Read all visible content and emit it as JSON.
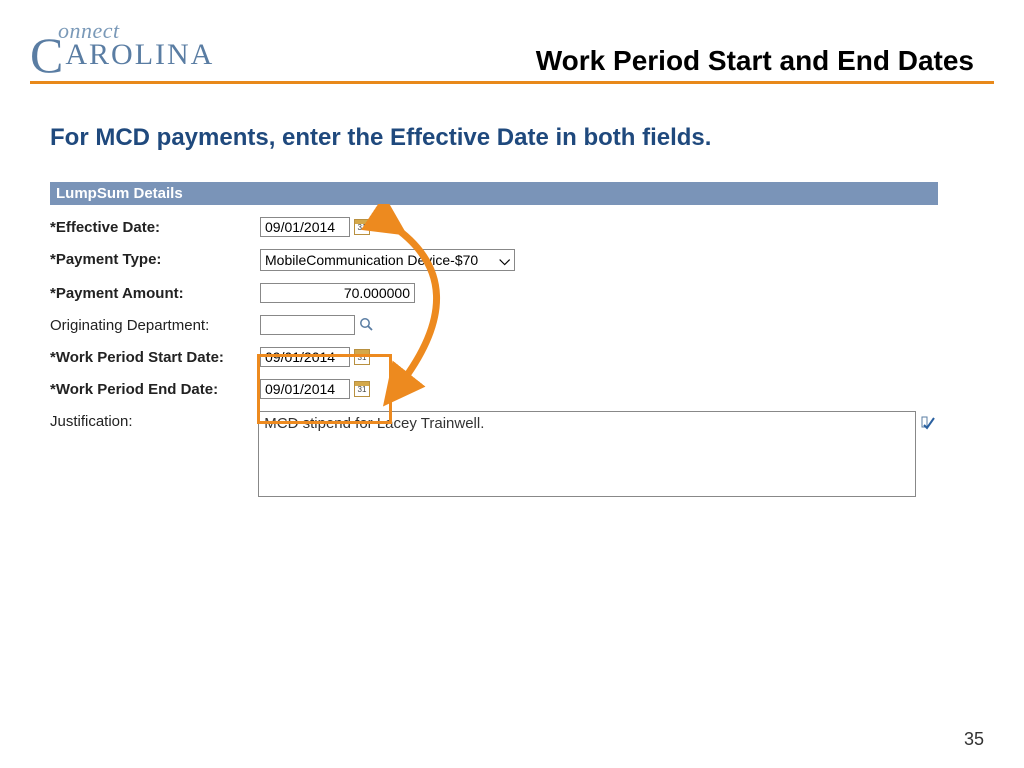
{
  "logo": {
    "top": "onnect",
    "bottom": "AROLINA"
  },
  "page_title": "Work Period Start and End Dates",
  "instruction": "For MCD payments, enter the Effective Date in both fields.",
  "section_header": "LumpSum Details",
  "fields": {
    "effective_date": {
      "label": "*Effective Date:",
      "value": "09/01/2014"
    },
    "payment_type": {
      "label": "*Payment Type:",
      "value": "MobileCommunication Device-$70"
    },
    "payment_amount": {
      "label": "*Payment Amount:",
      "value": "70.000000"
    },
    "orig_dept": {
      "label": " Originating Department:",
      "value": ""
    },
    "wp_start": {
      "label": "*Work Period Start Date:",
      "value": "09/01/2014"
    },
    "wp_end": {
      "label": "*Work Period End Date:",
      "value": "09/01/2014"
    },
    "justification": {
      "label": " Justification:",
      "value": "MCD stipend for Lacey Trainwell."
    }
  },
  "page_number": "35"
}
